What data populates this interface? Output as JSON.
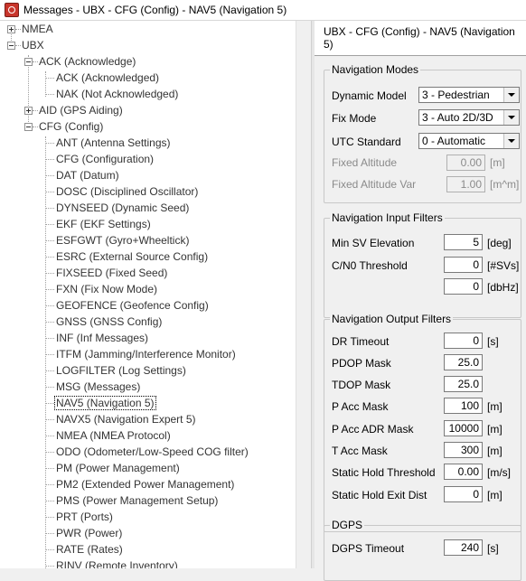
{
  "window": {
    "title": "Messages - UBX - CFG (Config) - NAV5 (Navigation 5)"
  },
  "tree": {
    "nmea": "NMEA",
    "ubx": "UBX",
    "ack": "ACK (Acknowledge)",
    "ack_children": [
      "ACK (Acknowledged)",
      "NAK (Not Acknowledged)"
    ],
    "aid": "AID (GPS Aiding)",
    "cfg": "CFG (Config)",
    "cfg_children": [
      "ANT (Antenna Settings)",
      "CFG (Configuration)",
      "DAT (Datum)",
      "DOSC (Disciplined Oscillator)",
      "DYNSEED (Dynamic Seed)",
      "EKF (EKF Settings)",
      "ESFGWT (Gyro+Wheeltick)",
      "ESRC (External Source Config)",
      "FIXSEED (Fixed Seed)",
      "FXN (Fix Now Mode)",
      "GEOFENCE (Geofence Config)",
      "GNSS (GNSS Config)",
      "INF (Inf Messages)",
      "ITFM (Jamming/Interference Monitor)",
      "LOGFILTER (Log Settings)",
      "MSG (Messages)",
      "NAV5 (Navigation 5)",
      "NAVX5 (Navigation Expert 5)",
      "NMEA (NMEA Protocol)",
      "ODO (Odometer/Low-Speed COG filter)",
      "PM (Power Management)",
      "PM2 (Extended Power Management)",
      "PMS (Power Management Setup)",
      "PRT (Ports)",
      "PWR (Power)",
      "RATE (Rates)",
      "RINV (Remote Inventory)"
    ],
    "selected": "NAV5 (Navigation 5)"
  },
  "panel": {
    "header": "UBX - CFG (Config) - NAV5 (Navigation 5)",
    "nav_modes": {
      "title": "Navigation Modes",
      "dynamic_model_label": "Dynamic Model",
      "dynamic_model_value": "3 - Pedestrian",
      "fix_mode_label": "Fix Mode",
      "fix_mode_value": "3 - Auto 2D/3D",
      "utc_label": "UTC Standard",
      "utc_value": "0 - Automatic",
      "fixed_alt_label": "Fixed Altitude",
      "fixed_alt_value": "0.00",
      "fixed_alt_unit": "[m]",
      "fixed_alt_var_label": "Fixed Altitude Var",
      "fixed_alt_var_value": "1.00",
      "fixed_alt_var_unit": "[m^m]"
    },
    "input_filters": {
      "title": "Navigation Input Filters",
      "min_sv_label": "Min SV Elevation",
      "min_sv_value": "5",
      "min_sv_unit": "[deg]",
      "cno_label": "C/N0 Threshold",
      "cno_value": "0",
      "cno_unit": "[#SVs]",
      "dbhz_value": "0",
      "dbhz_unit": "[dbHz]"
    },
    "output_filters": {
      "title": "Navigation Output Filters",
      "rows": [
        {
          "label": "DR Timeout",
          "value": "0",
          "unit": "[s]"
        },
        {
          "label": "PDOP Mask",
          "value": "25.0",
          "unit": ""
        },
        {
          "label": "TDOP Mask",
          "value": "25.0",
          "unit": ""
        },
        {
          "label": "P Acc Mask",
          "value": "100",
          "unit": "[m]"
        },
        {
          "label": "P Acc ADR Mask",
          "value": "10000",
          "unit": "[m]"
        },
        {
          "label": "T Acc Mask",
          "value": "300",
          "unit": "[m]"
        },
        {
          "label": "Static Hold Threshold",
          "value": "0.00",
          "unit": "[m/s]"
        },
        {
          "label": "Static Hold Exit Dist",
          "value": "0",
          "unit": "[m]"
        }
      ]
    },
    "dgps": {
      "title": "DGPS",
      "timeout_label": "DGPS Timeout",
      "timeout_value": "240",
      "timeout_unit": "[s]"
    }
  }
}
